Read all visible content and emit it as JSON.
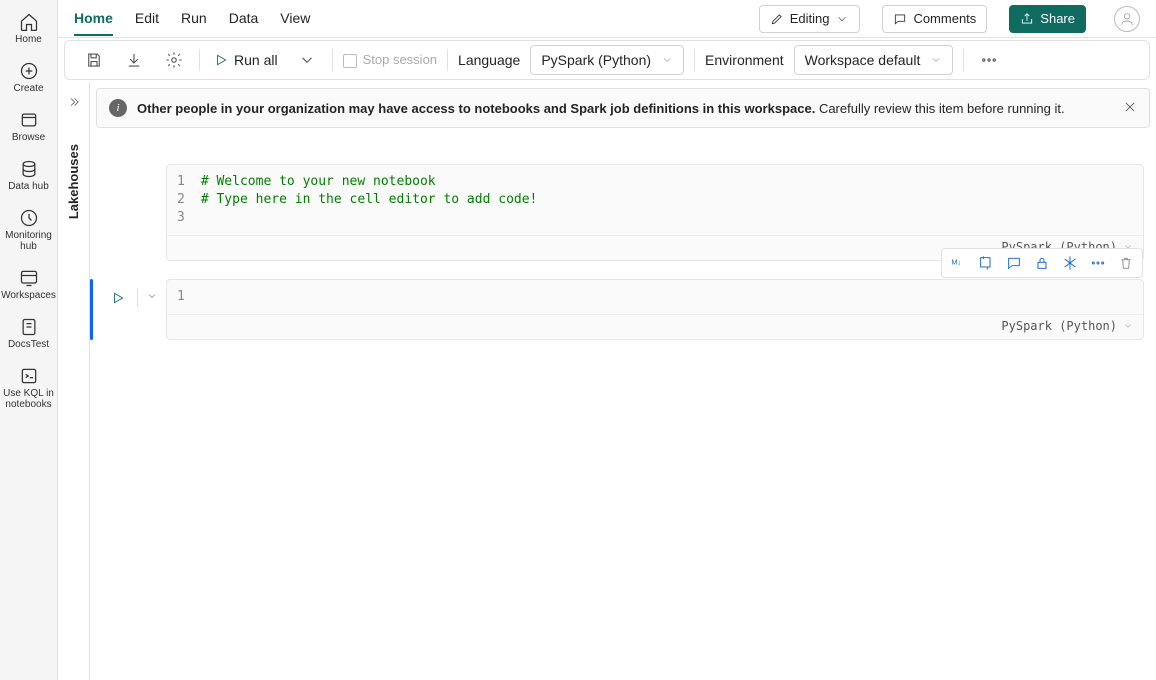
{
  "leftrail": [
    {
      "id": "home",
      "label": "Home"
    },
    {
      "id": "create",
      "label": "Create"
    },
    {
      "id": "browse",
      "label": "Browse"
    },
    {
      "id": "datahub",
      "label": "Data hub"
    },
    {
      "id": "monitoring",
      "label": "Monitoring hub"
    },
    {
      "id": "workspaces",
      "label": "Workspaces"
    },
    {
      "id": "docstest",
      "label": "DocsTest"
    },
    {
      "id": "kql",
      "label": "Use KQL in notebooks"
    }
  ],
  "tabs": {
    "home": "Home",
    "edit": "Edit",
    "run": "Run",
    "data": "Data",
    "view": "View"
  },
  "topright": {
    "editing": "Editing",
    "comments": "Comments",
    "share": "Share"
  },
  "cmdbar": {
    "runall": "Run all",
    "stop": "Stop session",
    "language_label": "Language",
    "language_value": "PySpark (Python)",
    "env_label": "Environment",
    "env_value": "Workspace default"
  },
  "explorer": {
    "title": "Lakehouses"
  },
  "banner": {
    "strong": "Other people in your organization may have access to notebooks and Spark job definitions in this workspace.",
    "rest": "Carefully review this item before running it."
  },
  "cells": [
    {
      "lines": [
        1,
        2,
        3
      ],
      "code": [
        "# Welcome to your new notebook",
        "# Type here in the cell editor to add code!",
        ""
      ],
      "lang": "PySpark (Python)",
      "selected": false,
      "showToolbar": false
    },
    {
      "lines": [
        1
      ],
      "code": [
        ""
      ],
      "lang": "PySpark (Python)",
      "selected": true,
      "showToolbar": true
    }
  ]
}
